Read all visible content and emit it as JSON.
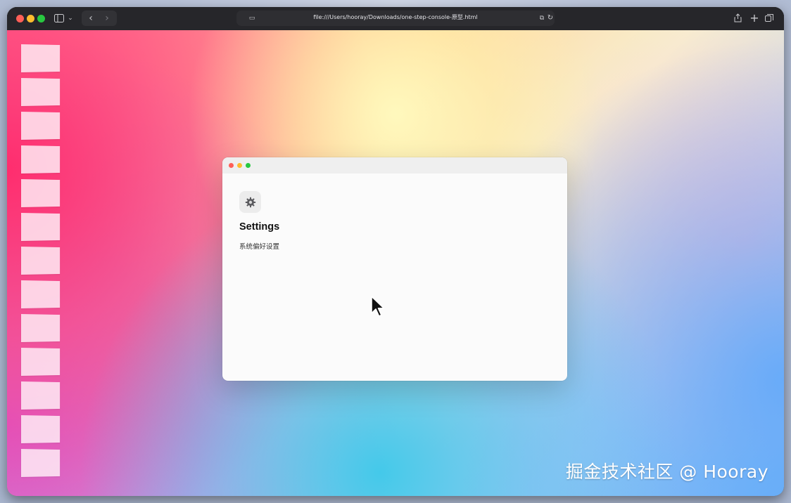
{
  "browser": {
    "address_url": "file:///Users/hooray/Downloads/one-step-console-原型.html"
  },
  "desktop": {
    "thumbnails": [
      {
        "label": ""
      },
      {
        "label": ""
      },
      {
        "label": ""
      },
      {
        "label": ""
      },
      {
        "label": ""
      },
      {
        "label": ""
      },
      {
        "label": ""
      },
      {
        "label": ""
      },
      {
        "label": ""
      },
      {
        "label": ""
      },
      {
        "label": ""
      },
      {
        "label": ""
      },
      {
        "label": ""
      }
    ]
  },
  "settings_window": {
    "title": "Settings",
    "subtitle": "系统偏好设置",
    "icon": "gear-icon"
  },
  "watermark": "掘金技术社区 @ Hooray",
  "colors": {
    "traffic_red": "#ff5f57",
    "traffic_yellow": "#febc2e",
    "traffic_green": "#28c840"
  }
}
